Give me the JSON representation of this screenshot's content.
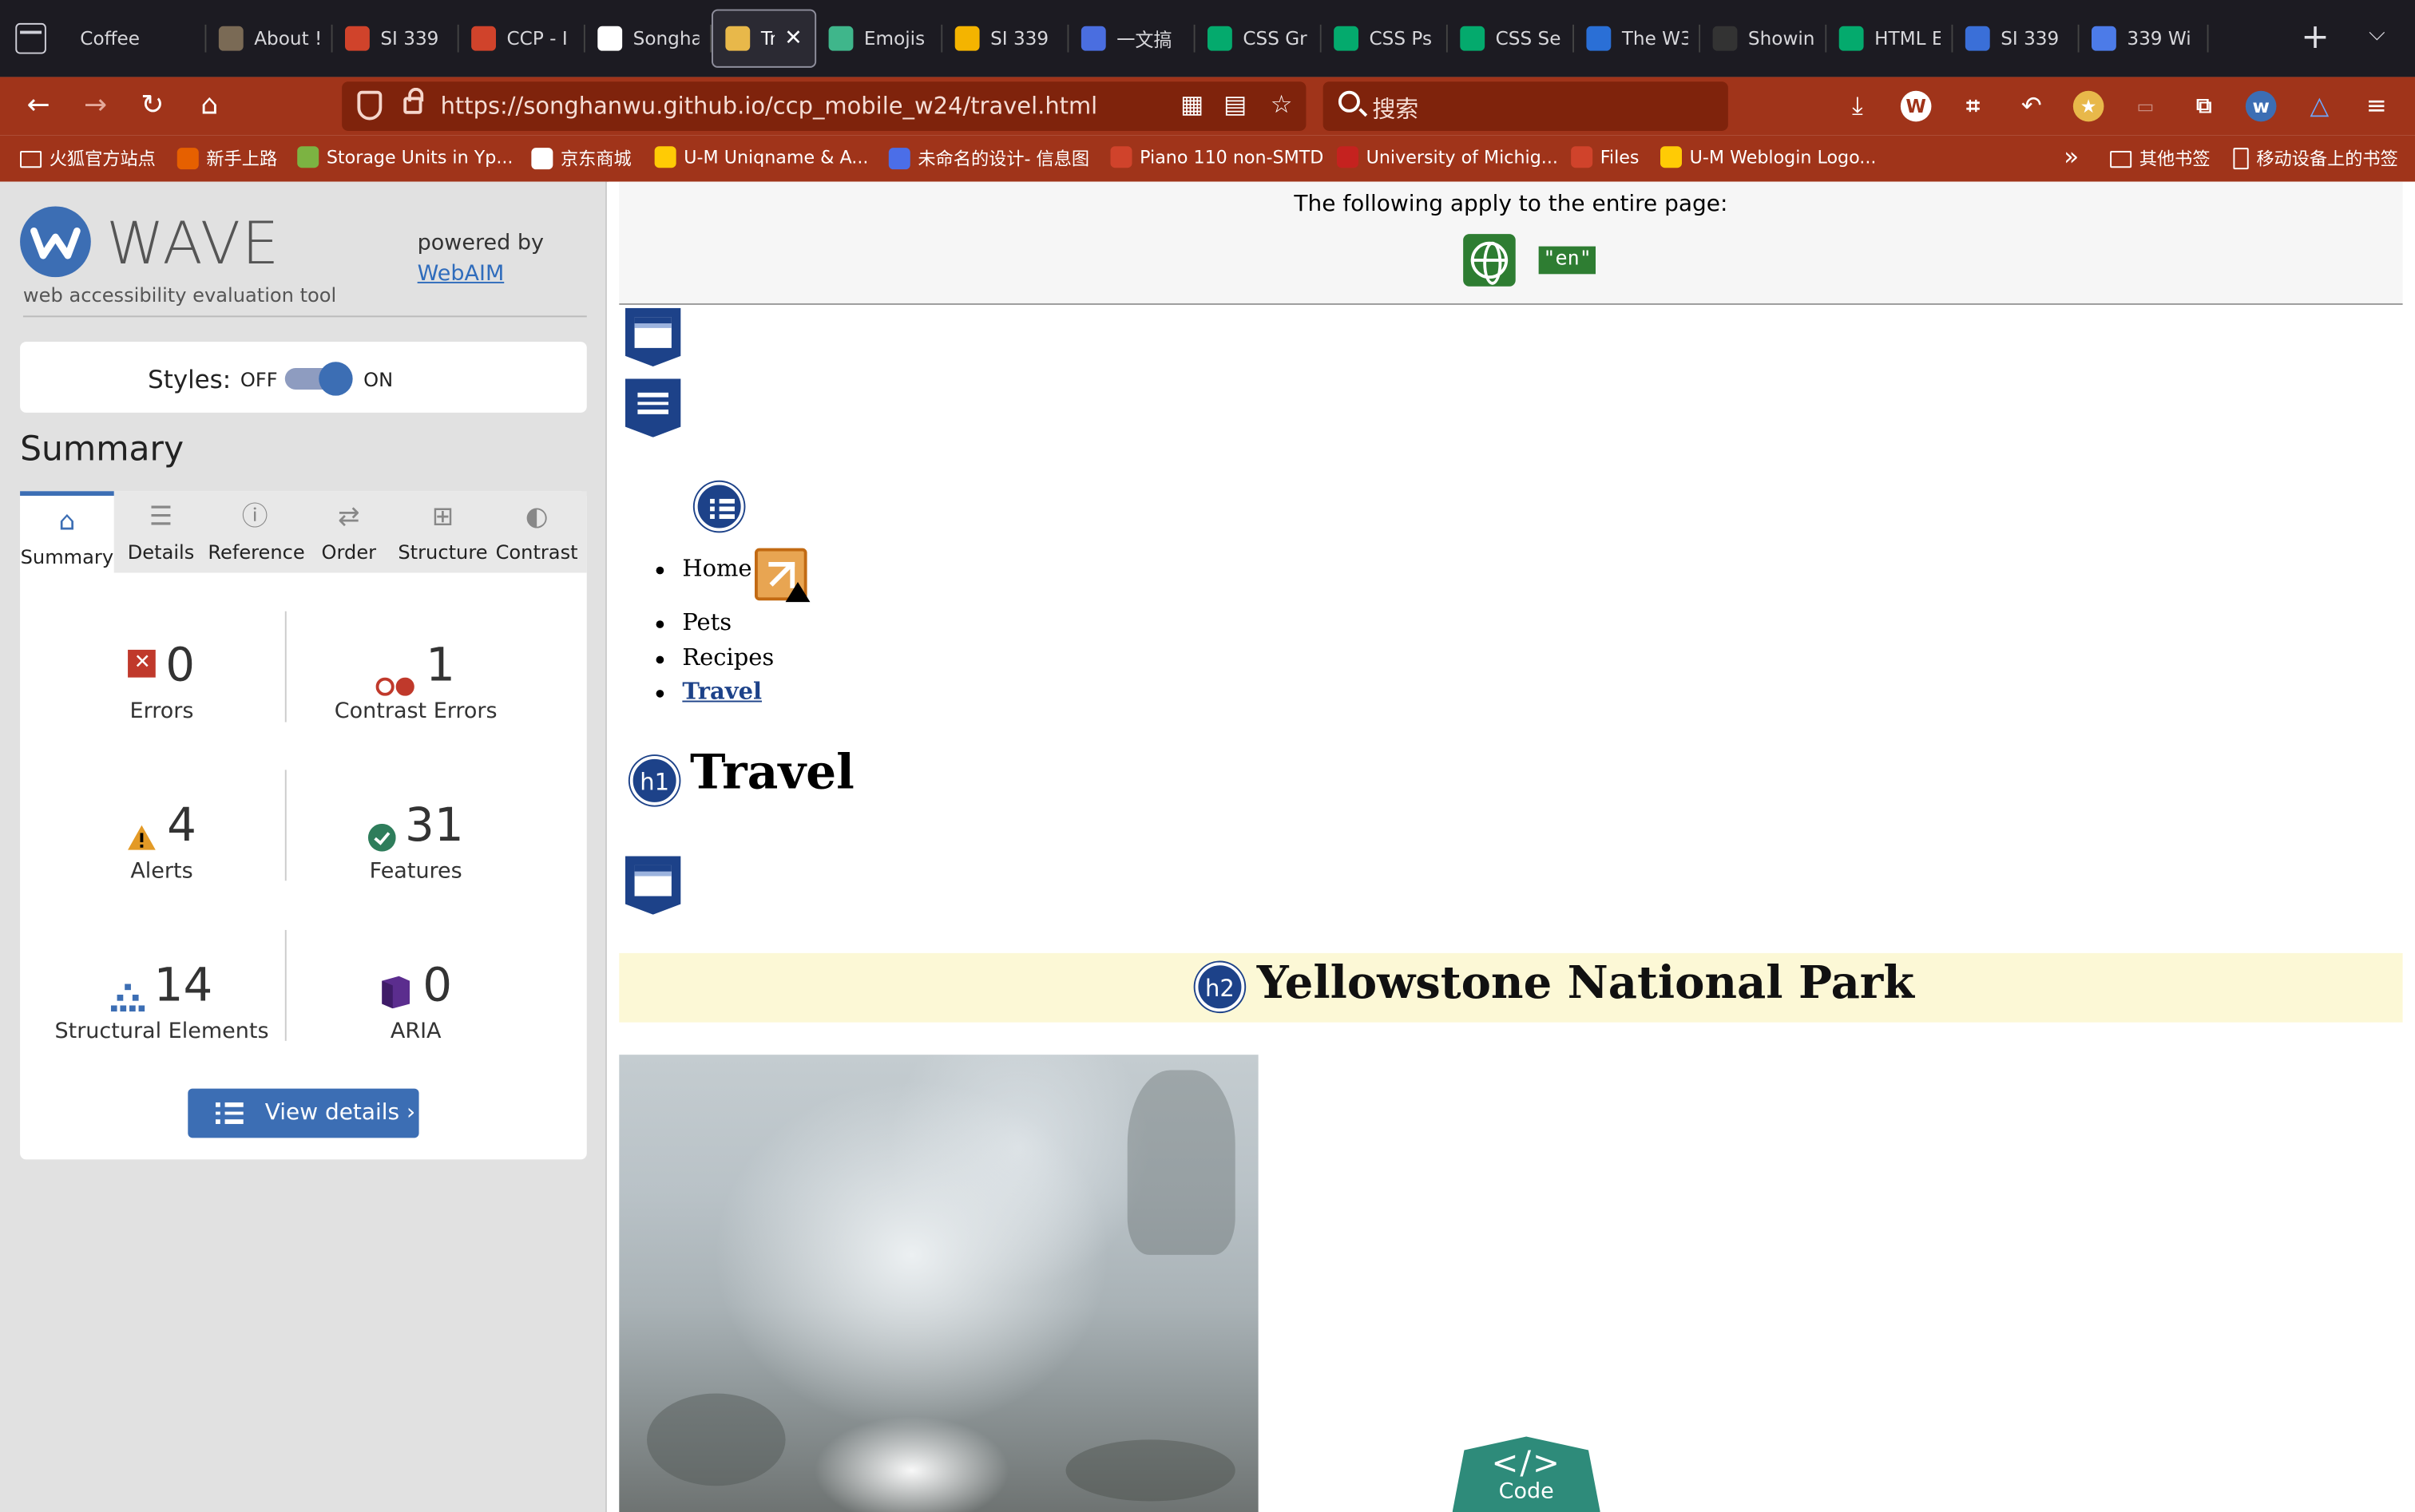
{
  "browser": {
    "tabs": [
      {
        "title": "Coffee",
        "fav_color": "",
        "active": false
      },
      {
        "title": "About !",
        "fav_color": "#7a6a55",
        "active": false
      },
      {
        "title": "SI 339",
        "fav_color": "#d0432b",
        "active": false
      },
      {
        "title": "CCP - I",
        "fav_color": "#d0432b",
        "active": false
      },
      {
        "title": "Songha",
        "fav_color": "#ffffff",
        "active": false
      },
      {
        "title": "Trav",
        "fav_color": "#e8b84a",
        "active": true
      },
      {
        "title": "Emojis",
        "fav_color": "#3fb68b",
        "active": false
      },
      {
        "title": "SI 339",
        "fav_color": "#f4b400",
        "active": false
      },
      {
        "title": "一文搞",
        "fav_color": "#4a6ee0",
        "active": false
      },
      {
        "title": "CSS Gr",
        "fav_color": "#04aa6d",
        "active": false
      },
      {
        "title": "CSS Ps",
        "fav_color": "#04aa6d",
        "active": false
      },
      {
        "title": "CSS Se",
        "fav_color": "#04aa6d",
        "active": false
      },
      {
        "title": "The W3",
        "fav_color": "#2a6fd6",
        "active": false
      },
      {
        "title": "Showin",
        "fav_color": "#333333",
        "active": false
      },
      {
        "title": "HTML E",
        "fav_color": "#04aa6d",
        "active": false
      },
      {
        "title": "SI 339",
        "fav_color": "#3a6fd8",
        "active": false
      },
      {
        "title": "339 Wi",
        "fav_color": "#4c7be8",
        "active": false
      }
    ],
    "tab_close_glyph": "✕",
    "new_tab_glyph": "+",
    "tab_menu_glyph": "⌵",
    "back_glyph": "←",
    "forward_glyph": "→",
    "reload_glyph": "↻",
    "home_glyph": "⌂",
    "url": "https://songhanwu.github.io/ccp_mobile_w24/travel.html",
    "search_placeholder": "搜索",
    "bookmarks": [
      {
        "label": "火狐官方站点",
        "kind": "folder"
      },
      {
        "label": "新手上路",
        "kind": "link",
        "color": "#e66000"
      },
      {
        "label": "Storage Units in Yp...",
        "kind": "link",
        "color": "#7cb342"
      },
      {
        "label": "京东商城",
        "kind": "link",
        "color": "#ffffff"
      },
      {
        "label": "U-M Uniqname & A...",
        "kind": "link",
        "color": "#ffcb05"
      },
      {
        "label": "未命名的设计- 信息图",
        "kind": "link",
        "color": "#4b6ee8"
      },
      {
        "label": "Piano 110 non-SMTD",
        "kind": "link",
        "color": "#d0432b"
      },
      {
        "label": "University of Michig...",
        "kind": "link",
        "color": "#c5221f"
      },
      {
        "label": "Files",
        "kind": "link",
        "color": "#d0432b"
      },
      {
        "label": "U-M Weblogin Logo...",
        "kind": "link",
        "color": "#ffcb05"
      }
    ],
    "bookmarks_overflow": "»",
    "other_bookmarks": "其他书签",
    "mobile_bookmarks": "移动设备上的书签"
  },
  "wave": {
    "title": "WAVE",
    "subtitle": "web accessibility evaluation tool",
    "powered_by": "powered by",
    "webaim": "WebAIM",
    "styles_label": "Styles:",
    "styles_off": "OFF",
    "styles_on": "ON",
    "summary_heading": "Summary",
    "tabs": [
      {
        "label": "Summary",
        "icon": "home-icon",
        "glyph": "⌂",
        "active": true
      },
      {
        "label": "Details",
        "icon": "list-icon",
        "glyph": "☰",
        "active": false
      },
      {
        "label": "Reference",
        "icon": "info-icon",
        "glyph": "ⓘ",
        "active": false
      },
      {
        "label": "Order",
        "icon": "order-icon",
        "glyph": "⇄",
        "active": false
      },
      {
        "label": "Structure",
        "icon": "structure-icon",
        "glyph": "⊞",
        "active": false
      },
      {
        "label": "Contrast",
        "icon": "contrast-icon",
        "glyph": "◐",
        "active": false
      }
    ],
    "stats": {
      "errors": {
        "value": "0",
        "label": "Errors"
      },
      "contrast": {
        "value": "1",
        "label": "Contrast Errors"
      },
      "alerts": {
        "value": "4",
        "label": "Alerts"
      },
      "features": {
        "value": "31",
        "label": "Features"
      },
      "structural": {
        "value": "14",
        "label": "Structural Elements"
      },
      "aria": {
        "value": "0",
        "label": "ARIA"
      }
    },
    "view_details": "View details ›"
  },
  "page": {
    "applies_text": "The following apply to the entire page:",
    "lang_badge": "\"en\"",
    "nav_items": [
      "Home",
      "Pets",
      "Recipes",
      "Travel"
    ],
    "h1_badge": "h1",
    "h1": "Travel",
    "h2_badge": "h2",
    "h2": "Yellowstone National Park",
    "code_glyph": "</>",
    "code_label": "Code"
  }
}
